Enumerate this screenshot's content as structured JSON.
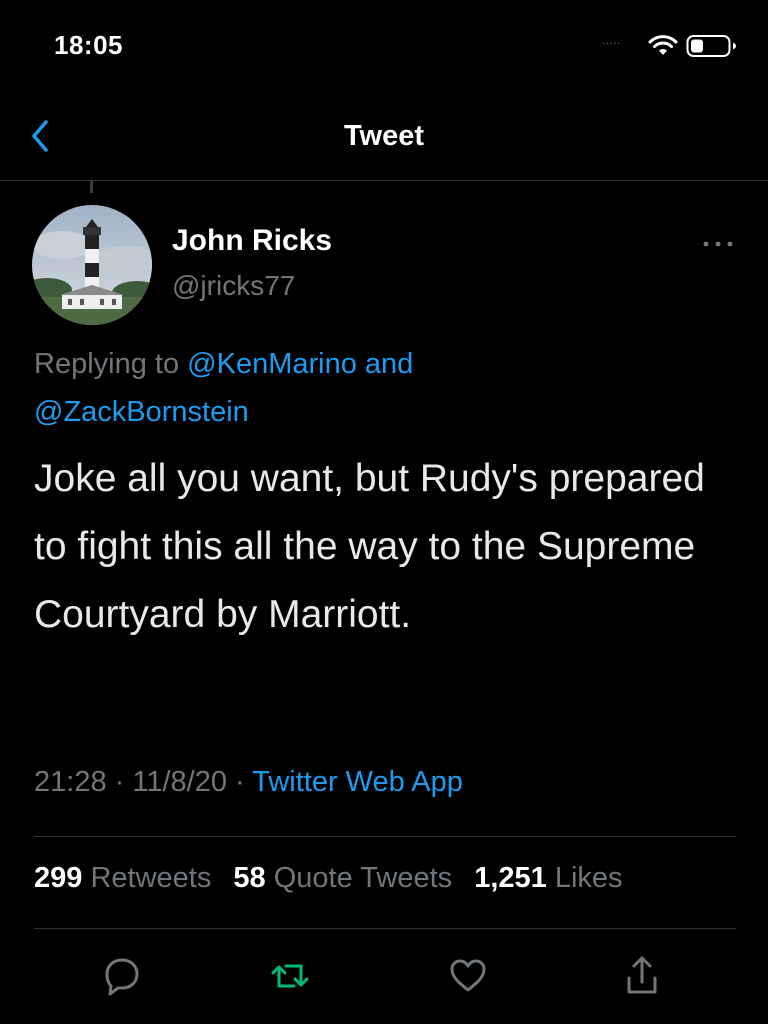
{
  "status_bar": {
    "time": "18:05",
    "signal": "....."
  },
  "nav": {
    "title": "Tweet",
    "back_icon": "chevron-left-icon"
  },
  "tweet": {
    "author_name": "John Ricks",
    "author_handle": "@jricks77",
    "avatar_icon": "lighthouse-avatar",
    "replying_prefix": "Replying to ",
    "replying_mention_1": "@KenMarino",
    "replying_and": " and",
    "replying_mention_2": "@ZackBornstein",
    "text": "Joke all you want, but Rudy's prepared to fight this all the way to the Supreme Courtyard by Marriott.",
    "time": "21:28",
    "sep": " · ",
    "date": "11/8/20",
    "source": "Twitter Web App"
  },
  "stats": {
    "retweets_count": "299",
    "retweets_label": "Retweets",
    "quotes_count": "58",
    "quotes_label": "Quote Tweets",
    "likes_count": "1,251",
    "likes_label": "Likes"
  },
  "actions": {
    "reply_icon": "reply-icon",
    "retweet_icon": "retweet-icon",
    "like_icon": "heart-icon",
    "share_icon": "share-icon"
  },
  "colors": {
    "background": "#000000",
    "accent": "#1d9bf0",
    "retweet_green": "#00ba7c",
    "secondary_text": "#71767b"
  }
}
